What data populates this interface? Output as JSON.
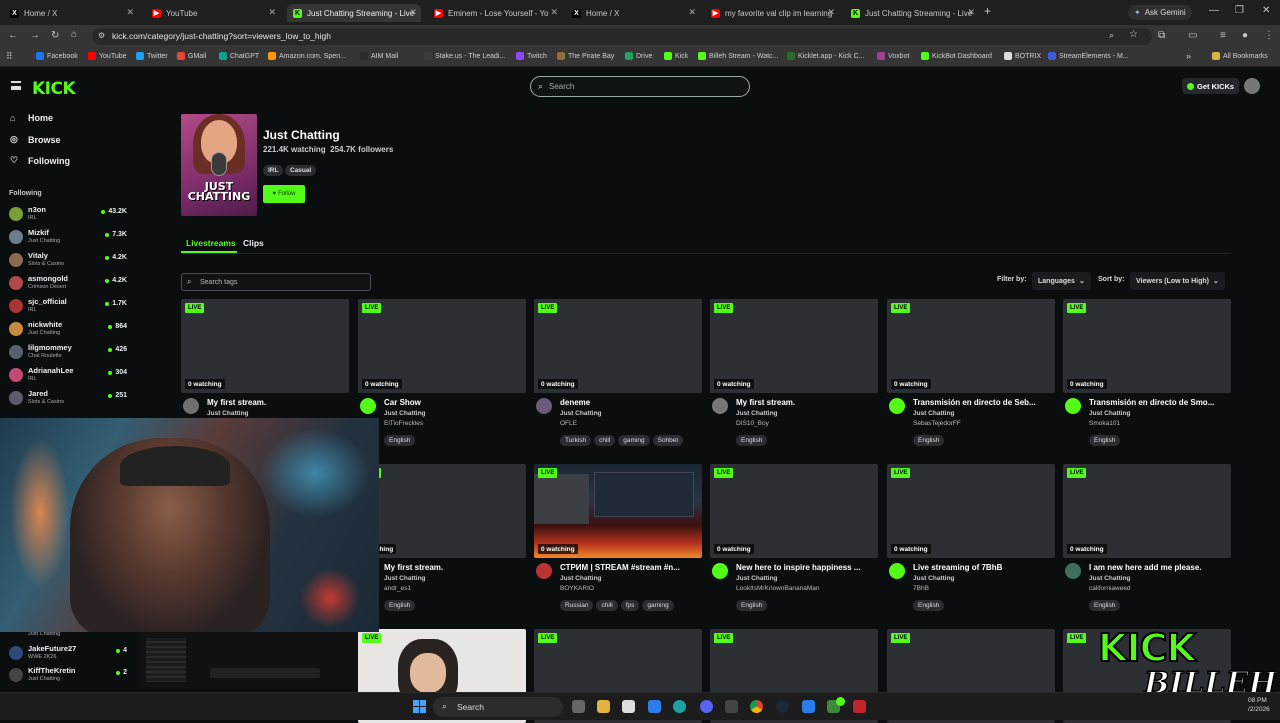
{
  "browser": {
    "tabs": [
      {
        "title": "Home / X",
        "favicon": "x-icon",
        "active": false
      },
      {
        "title": "YouTube",
        "favicon": "youtube-icon",
        "active": false
      },
      {
        "title": "Just Chatting Streaming - Live",
        "favicon": "kick-icon",
        "active": true
      },
      {
        "title": "Eminem - Lose Yourself - Yo",
        "favicon": "youtube-icon",
        "active": false
      },
      {
        "title": "Home / X",
        "favicon": "x-icon",
        "active": false
      },
      {
        "title": "my favorite val clip im learning",
        "favicon": "youtube-icon",
        "active": false
      },
      {
        "title": "Just Chatting Streaming - Live",
        "favicon": "kick-icon",
        "active": false
      }
    ],
    "new_tab": "+",
    "ask_gemini": "Ask Gemini",
    "url": "kick.com/category/just-chatting?sort=viewers_low_to_high",
    "bookmarks": [
      "Facebook",
      "YouTube",
      "Twitter",
      "GMail",
      "ChatGPT",
      "Amazon.com. Spen...",
      "AIM Mail",
      "Stake.us - The Leadi...",
      "Twitch",
      "The Pirate Bay",
      "Drive",
      "Kick",
      "Billeh Stream - Watc...",
      "Kicklet.app - Kick C...",
      "Voxbot",
      "KickBot Dashboard",
      "BOTRIX",
      "StreamElements - M..."
    ],
    "all_bookmarks": "All Bookmarks"
  },
  "kick": {
    "logo": "KICK",
    "search_placeholder": "Search",
    "get_kicks": "Get KICKs",
    "nav": [
      {
        "label": "Home",
        "icon": "home-icon"
      },
      {
        "label": "Browse",
        "icon": "compass-icon"
      },
      {
        "label": "Following",
        "icon": "heart-icon"
      }
    ],
    "following_header": "Following",
    "following": [
      {
        "name": "n3on",
        "category": "IRL",
        "viewers": "43.2K",
        "color": "#7a9d3a"
      },
      {
        "name": "Mizkif",
        "category": "Just Chatting",
        "viewers": "7.3K",
        "color": "#6b7d8f"
      },
      {
        "name": "Vitaly",
        "category": "Slots & Casino",
        "viewers": "4.2K",
        "color": "#8c6a4f"
      },
      {
        "name": "asmongold",
        "category": "Crimson Desert",
        "viewers": "4.2K",
        "color": "#b04a4a"
      },
      {
        "name": "sjc_official",
        "category": "IRL",
        "viewers": "1.7K",
        "color": "#a33"
      },
      {
        "name": "nickwhite",
        "category": "Just Chatting",
        "viewers": "864",
        "color": "#c58b3f"
      },
      {
        "name": "lilgmommey",
        "category": "Chat Roulette",
        "viewers": "426",
        "color": "#55616d"
      },
      {
        "name": "AdrianahLee",
        "category": "IRL",
        "viewers": "304",
        "color": "#c4497a"
      },
      {
        "name": "Jared",
        "category": "Slots & Casino",
        "viewers": "251",
        "color": "#5b5b6b"
      }
    ],
    "following_bottom": [
      {
        "name": "JakeFuture27",
        "category": "WWE 2K26",
        "viewers": "4",
        "color": "#2f4a7a"
      },
      {
        "name": "KiffTheKretin",
        "category": "Just Chatting",
        "viewers": "2",
        "color": "#444"
      }
    ],
    "following_partial_category": "Just Chatting",
    "category": {
      "title": "Just Chatting",
      "watching": "221.4K watching",
      "followers": "254.7K followers",
      "tags": [
        "IRL",
        "Casual"
      ],
      "follow_label": "Follow",
      "hero_text": "JUST CHATTING"
    },
    "page_tabs": [
      "Livestreams",
      "Clips"
    ],
    "search_tags_placeholder": "Search tags",
    "filter_by": "Filter by:",
    "languages": "Languages",
    "sort_by": "Sort by:",
    "sort_value": "Viewers (Low to High)",
    "live_label": "LIVE",
    "streams_row1": [
      {
        "title": "My first stream.",
        "category": "Just Chatting",
        "user": "",
        "watching": "0 watching",
        "tags": [],
        "avatar": "#6f6f6f"
      },
      {
        "title": "Car Show",
        "category": "Just Chatting",
        "user": "ElTioFreckles",
        "watching": "0 watching",
        "tags": [
          "English"
        ],
        "avatar": "#53fc18"
      },
      {
        "title": "deneme",
        "category": "Just Chatting",
        "user": "OFLE",
        "watching": "0 watching",
        "tags": [
          "Turkish",
          "chill",
          "gaming",
          "Sohbet"
        ],
        "avatar": "#6b5a7a"
      },
      {
        "title": "My first stream.",
        "category": "Just Chatting",
        "user": "DIS10_Boy",
        "watching": "0 watching",
        "tags": [
          "English"
        ],
        "avatar": "#777"
      },
      {
        "title": "Transmisión en directo de Seb...",
        "category": "Just Chatting",
        "user": "SebasTejedorFF",
        "watching": "0 watching",
        "tags": [
          "English"
        ],
        "avatar": "#53fc18"
      },
      {
        "title": "Transmisión en directo de Smo...",
        "category": "Just Chatting",
        "user": "Smoka101",
        "watching": "0 watching",
        "tags": [
          "English"
        ],
        "avatar": "#53fc18"
      }
    ],
    "streams_row2": [
      {
        "title": "My first stream.",
        "category": "Just Chatting",
        "user": "andr_es1",
        "watching": "watching",
        "tags": [
          "English"
        ],
        "avatar": ""
      },
      {
        "title": "СТРИМ | STREAM #stream #n...",
        "category": "Just Chatting",
        "user": "BOYKARIO",
        "watching": "0 watching",
        "tags": [
          "Russian",
          "chill",
          "fps",
          "gaming"
        ],
        "avatar": "#b33"
      },
      {
        "title": "New here to inspire happiness ...",
        "category": "Just Chatting",
        "user": "LookItsMrKnownBananaMan",
        "watching": "0 watching",
        "tags": [
          "English"
        ],
        "avatar": "#53fc18"
      },
      {
        "title": "Live streaming of 7BhB",
        "category": "Just Chatting",
        "user": "7BhB",
        "watching": "0 watching",
        "tags": [
          "English"
        ],
        "avatar": "#53fc18"
      },
      {
        "title": "I am new here add me please.",
        "category": "Just Chatting",
        "user": "californiaweed",
        "watching": "0 watching",
        "tags": [
          "English"
        ],
        "avatar": "#3f6f5a"
      }
    ],
    "overlay_brand": [
      "KICK",
      "BILLEH"
    ]
  },
  "taskbar": {
    "search": "Search",
    "time": "08 PM",
    "date": "/2/2026"
  }
}
